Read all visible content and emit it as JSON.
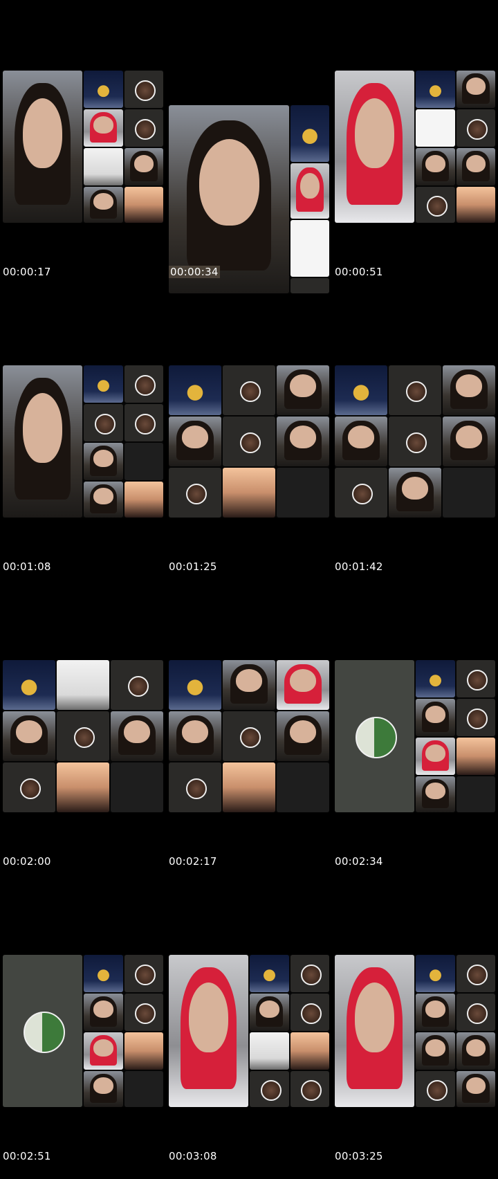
{
  "thumbnails": [
    {
      "timestamp": "00:00:17"
    },
    {
      "timestamp": "00:00:34"
    },
    {
      "timestamp": "00:00:51"
    },
    {
      "timestamp": "00:01:08"
    },
    {
      "timestamp": "00:01:25"
    },
    {
      "timestamp": "00:01:42"
    },
    {
      "timestamp": "00:02:00"
    },
    {
      "timestamp": "00:02:17"
    },
    {
      "timestamp": "00:02:34"
    },
    {
      "timestamp": "00:02:51"
    },
    {
      "timestamp": "00:03:08"
    },
    {
      "timestamp": "00:03:25"
    }
  ]
}
